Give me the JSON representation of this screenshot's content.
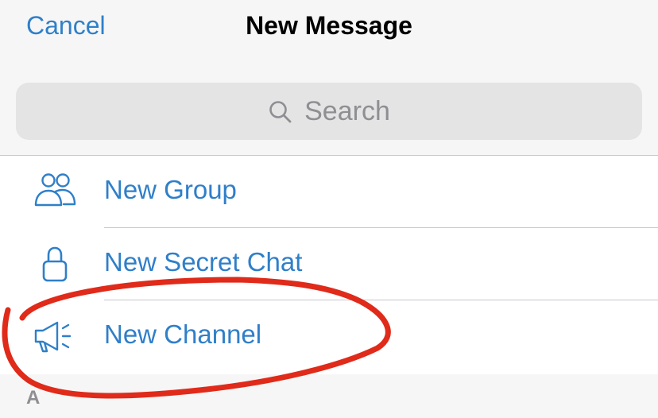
{
  "header": {
    "cancel_label": "Cancel",
    "title": "New Message"
  },
  "search": {
    "placeholder": "Search",
    "icon": "search-icon"
  },
  "menu": {
    "items": [
      {
        "label": "New Group",
        "icon": "group-icon"
      },
      {
        "label": "New Secret Chat",
        "icon": "lock-icon"
      },
      {
        "label": "New Channel",
        "icon": "megaphone-icon"
      }
    ]
  },
  "section": {
    "letter": "A"
  },
  "colors": {
    "accent": "#2f7fc9",
    "header_background": "#f6f6f6",
    "search_background": "#e4e4e5",
    "placeholder": "#8e8e93",
    "annotation_circle": "#e02a1a"
  }
}
